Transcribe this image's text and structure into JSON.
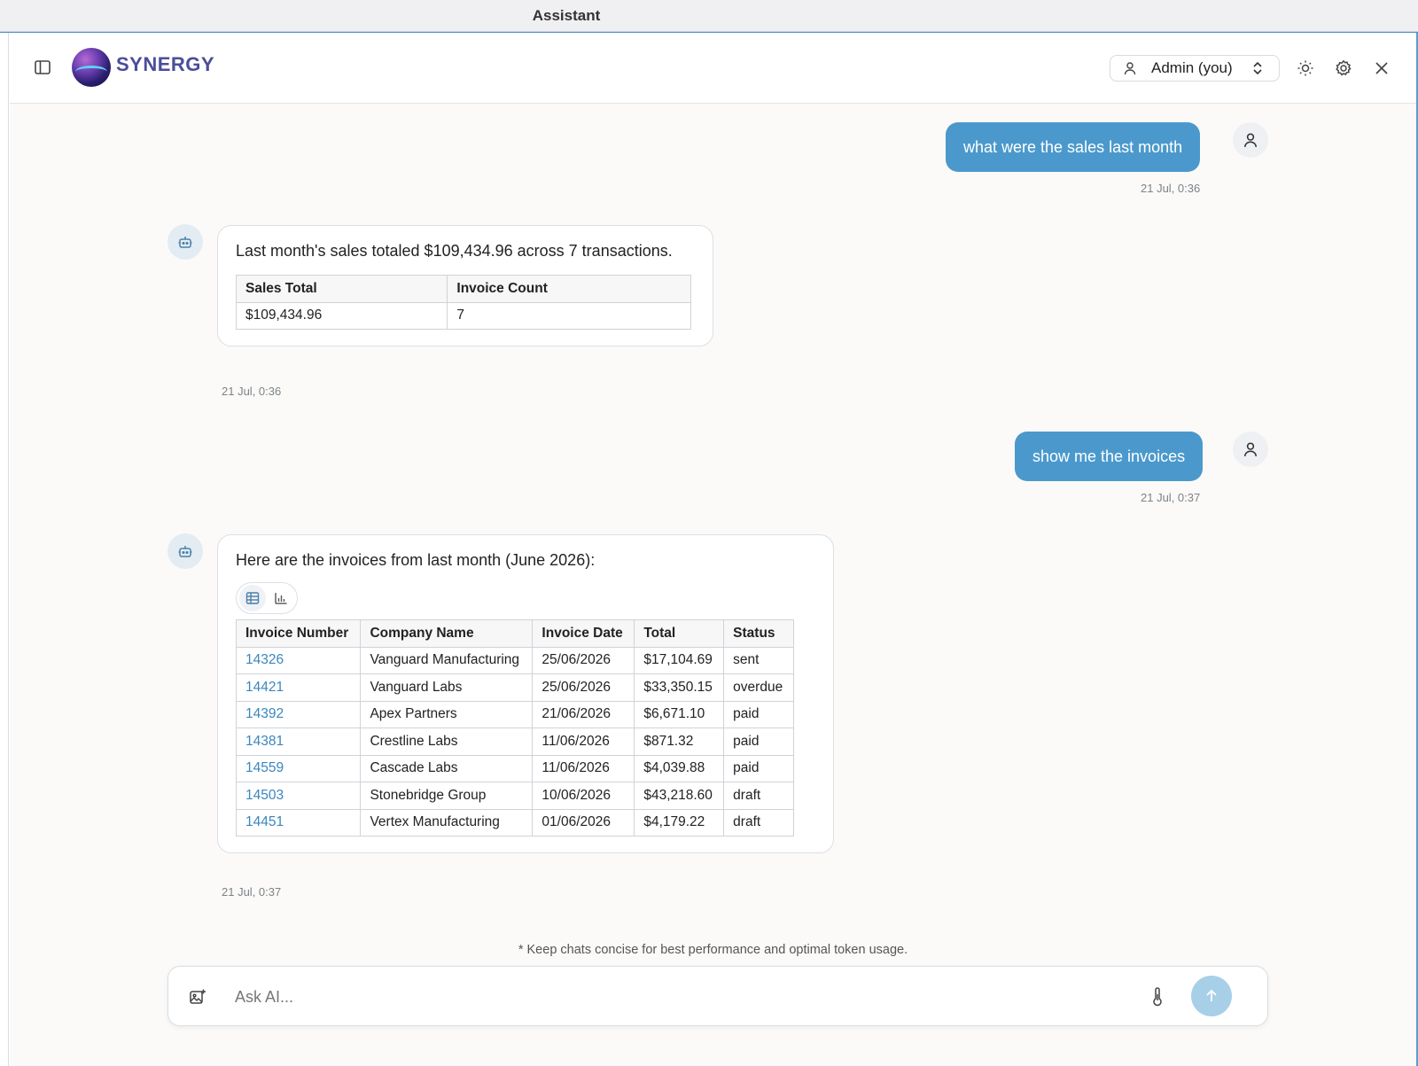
{
  "window": {
    "title": "Assistant"
  },
  "header": {
    "brand": "SYNERGY",
    "user_label": "Admin (you)"
  },
  "messages": [
    {
      "role": "user",
      "text": "what were the sales last month",
      "time": "21 Jul, 0:36"
    },
    {
      "role": "assistant",
      "text": "Last month's sales totaled $109,434.96 across 7 transactions.",
      "table": {
        "columns": [
          "Sales Total",
          "Invoice Count"
        ],
        "rows": [
          [
            "$109,434.96",
            "7"
          ]
        ]
      },
      "time": "21 Jul, 0:36"
    },
    {
      "role": "user",
      "text": "show me the invoices",
      "time": "21 Jul, 0:37"
    },
    {
      "role": "assistant",
      "text": "Here are the invoices from last month (June 2026):",
      "view_toggle": {
        "active": "table",
        "options": [
          "table-view-icon",
          "chart-view-icon"
        ]
      },
      "table": {
        "columns": [
          "Invoice Number",
          "Company Name",
          "Invoice Date",
          "Total",
          "Status"
        ],
        "rows": [
          [
            "14326",
            "Vanguard Manufacturing",
            "25/06/2026",
            "$17,104.69",
            "sent"
          ],
          [
            "14421",
            "Vanguard Labs",
            "25/06/2026",
            "$33,350.15",
            "overdue"
          ],
          [
            "14392",
            "Apex Partners",
            "21/06/2026",
            "$6,671.10",
            "paid"
          ],
          [
            "14381",
            "Crestline Labs",
            "11/06/2026",
            "$871.32",
            "paid"
          ],
          [
            "14559",
            "Cascade Labs",
            "11/06/2026",
            "$4,039.88",
            "paid"
          ],
          [
            "14503",
            "Stonebridge Group",
            "10/06/2026",
            "$43,218.60",
            "draft"
          ],
          [
            "14451",
            "Vertex Manufacturing",
            "01/06/2026",
            "$4,179.22",
            "draft"
          ]
        ]
      },
      "time": "21 Jul, 0:37"
    }
  ],
  "footer": {
    "disclaimer": "* Keep chats concise for best performance and optimal token usage.",
    "input_placeholder": "Ask AI...",
    "input_value": ""
  },
  "colors": {
    "accent": "#4b99cc",
    "link": "#3a86bf",
    "send_disabled": "#a7cfe8",
    "brand_text": "#4a4e9a"
  }
}
